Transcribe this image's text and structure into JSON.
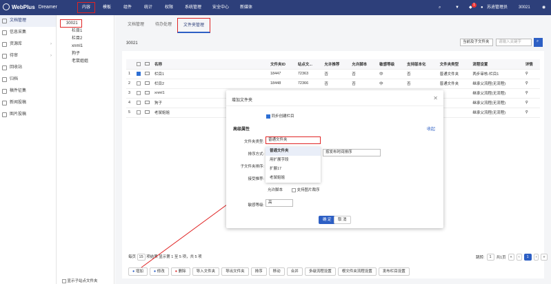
{
  "app": {
    "logo": "WebPlus",
    "sub": "Dreamer"
  },
  "topnav": [
    "内容",
    "模板",
    "组件",
    "统计",
    "权限",
    "系统管理",
    "安全中心",
    "新媒体"
  ],
  "user": {
    "name": "苏迪管理员",
    "site": "30021",
    "badge": "1"
  },
  "sidebar": [
    "文档管理",
    "信息采集",
    "资源库",
    "待审",
    "回收站",
    "归档",
    "稿件征集",
    "新闻投稿",
    "图片投稿"
  ],
  "tree": {
    "root": "30021",
    "children": [
      "栏目1",
      "栏目2",
      "xnml1",
      "狗子",
      "老鼠姐姐"
    ]
  },
  "tabs": [
    "文档管理",
    "待办处理",
    "文件夹管理"
  ],
  "panel": {
    "title": "30021",
    "scope": "当前及子文件夹",
    "search_placeholder": "请输入关键字"
  },
  "table": {
    "headers": [
      "名称",
      "文件夹ID",
      "站点文...",
      "允许推荐",
      "允许脚本",
      "敏感等级",
      "支持版本化",
      "文件夹类型",
      "流程设置",
      "详情"
    ],
    "rows": [
      {
        "no": "1",
        "name": "栏目1",
        "id": "18447",
        "site": "72363",
        "rec": "否",
        "script": "否",
        "level": "中",
        "ver": "否",
        "type": "普通文件夹",
        "flow": "两步审核-栏目1"
      },
      {
        "no": "2",
        "name": "栏目2",
        "id": "18448",
        "site": "72366",
        "rec": "否",
        "script": "否",
        "level": "中",
        "ver": "否",
        "type": "普通文件夹",
        "flow": "继承父流程(无流程)"
      },
      {
        "no": "3",
        "name": "xnml1",
        "id": "",
        "site": "",
        "rec": "",
        "script": "",
        "level": "",
        "ver": "",
        "type": "",
        "flow": "继承父流程(无流程)"
      },
      {
        "no": "4",
        "name": "狗子",
        "id": "",
        "site": "",
        "rec": "",
        "script": "",
        "level": "",
        "ver": "",
        "type": "",
        "flow": "继承父流程(无流程)"
      },
      {
        "no": "5",
        "name": "老鼠姐姐",
        "id": "",
        "site": "",
        "rec": "",
        "script": "",
        "level": "",
        "ver": "",
        "type": "",
        "flow": "继承父流程(无流程)"
      }
    ]
  },
  "pager": {
    "left": "每页",
    "size": "15",
    "info": "项结果 显示第 1 至 5 项，共 5 项",
    "jump": "跳转:",
    "page": "1",
    "total": "共1页",
    "cur": "1"
  },
  "toolbar": [
    "增加",
    "修改",
    "删除",
    "导入文件夹",
    "导出文件夹",
    "排序",
    "移动",
    "合并",
    "多级流程设置",
    "根文件夹流程设置",
    "发布栏目设置"
  ],
  "show_sub": "显示子站点文件夹",
  "modal": {
    "title": "增加文件夹",
    "sync": "同步创建栏目",
    "section": "高级属性",
    "collapse": "收起",
    "type_label": "文件夹类型:",
    "type_value": "普通文件夹",
    "sort_label": "排序方式:",
    "sort_value": "按发布时间排序",
    "sub_label": "子文件夹排序:",
    "rec_label": "接受推荐:",
    "opt_script": "允许脚本",
    "opt_pic": "支持图片裁序",
    "level_label": "敏感等级:",
    "level_value": "高",
    "ok": "确 定",
    "cancel": "取 消",
    "options": [
      "普通文件夹",
      "用扩展字段",
      "扩展17",
      "老鼠姐姐"
    ]
  }
}
